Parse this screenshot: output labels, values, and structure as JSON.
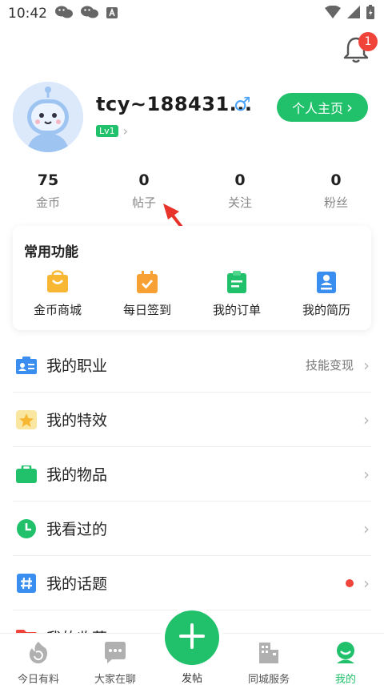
{
  "status_bar": {
    "time": "10:42"
  },
  "notifications": {
    "badge": "1"
  },
  "profile": {
    "username": "tcy~188431...",
    "gender_symbol": "♂",
    "level": "Lv1",
    "home_button": "个人主页",
    "chevron": "›"
  },
  "stats": [
    {
      "value": "75",
      "label": "金币"
    },
    {
      "value": "0",
      "label": "帖子"
    },
    {
      "value": "0",
      "label": "关注"
    },
    {
      "value": "0",
      "label": "粉丝"
    }
  ],
  "functions": {
    "title": "常用功能",
    "items": [
      {
        "label": "金币商城",
        "icon": "shopping-bag-icon",
        "color": "#f7b733"
      },
      {
        "label": "每日签到",
        "icon": "calendar-check-icon",
        "color": "#f7a033"
      },
      {
        "label": "我的订单",
        "icon": "clipboard-icon",
        "color": "#21c16b"
      },
      {
        "label": "我的简历",
        "icon": "resume-icon",
        "color": "#3a8ef0"
      }
    ]
  },
  "menu": [
    {
      "label": "我的职业",
      "right": "技能变现",
      "icon": "id-card-icon"
    },
    {
      "label": "我的特效",
      "right": "",
      "icon": "star-effect-icon"
    },
    {
      "label": "我的物品",
      "right": "",
      "icon": "briefcase-icon"
    },
    {
      "label": "我看过的",
      "right": "",
      "icon": "clock-icon"
    },
    {
      "label": "我的话题",
      "right": "",
      "icon": "hashtag-icon",
      "dot": true
    },
    {
      "label": "我的收藏",
      "right": "",
      "icon": "folder-icon"
    }
  ],
  "tabbar": [
    {
      "label": "今日有料",
      "icon": "refresh-flame-icon"
    },
    {
      "label": "大家在聊",
      "icon": "chat-bubble-icon"
    },
    {
      "label": "发帖",
      "icon": "plus-icon"
    },
    {
      "label": "同城服务",
      "icon": "buildings-icon"
    },
    {
      "label": "我的",
      "icon": "user-face-icon",
      "active": true
    }
  ],
  "colors": {
    "accent": "#21c16b",
    "badge": "#f0433a"
  }
}
